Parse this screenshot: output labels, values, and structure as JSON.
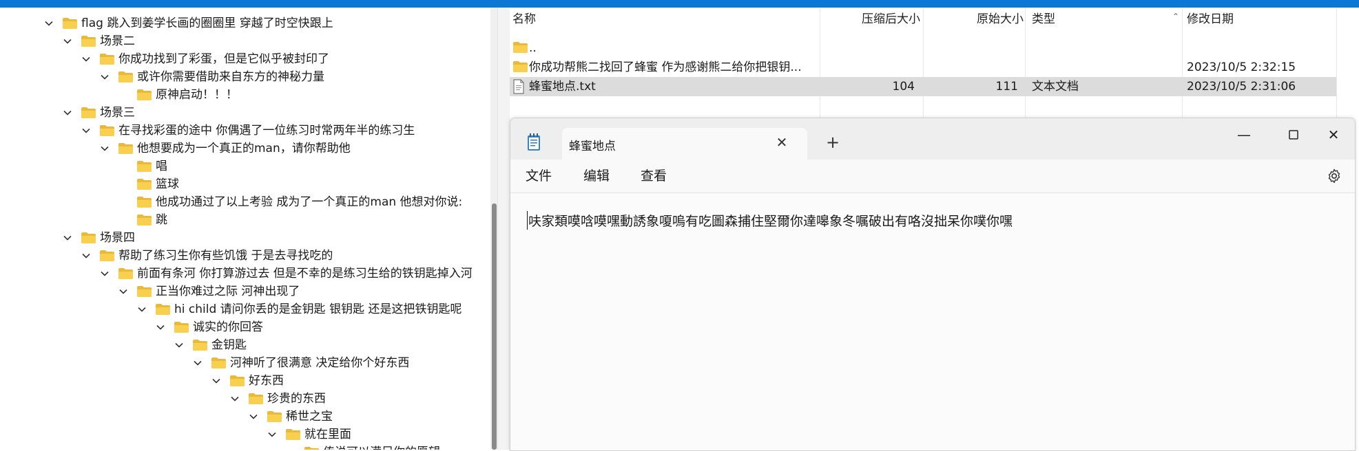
{
  "tree": {
    "nodes": [
      {
        "label": "flag 跳入到姜学长画的圈圈里 穿越了时空快跟上",
        "depth": 0,
        "expanded": true
      },
      {
        "label": "场景二",
        "depth": 1,
        "expanded": true
      },
      {
        "label": "你成功找到了彩蛋，但是它似乎被封印了",
        "depth": 2,
        "expanded": true
      },
      {
        "label": "或许你需要借助来自东方的神秘力量",
        "depth": 3,
        "expanded": true
      },
      {
        "label": "原神启动！！！",
        "depth": 4,
        "expanded": false
      },
      {
        "label": "场景三",
        "depth": 1,
        "expanded": true
      },
      {
        "label": "在寻找彩蛋的途中 你偶遇了一位练习时常两年半的练习生",
        "depth": 2,
        "expanded": true
      },
      {
        "label": "他想要成为一个真正的man，请你帮助他",
        "depth": 3,
        "expanded": true
      },
      {
        "label": "唱",
        "depth": 4,
        "expanded": false
      },
      {
        "label": "篮球",
        "depth": 4,
        "expanded": false
      },
      {
        "label": "他成功通过了以上考验 成为了一个真正的man 他想对你说:",
        "depth": 4,
        "expanded": false
      },
      {
        "label": "跳",
        "depth": 4,
        "expanded": false
      },
      {
        "label": "场景四",
        "depth": 1,
        "expanded": true
      },
      {
        "label": "帮助了练习生你有些饥饿 于是去寻找吃的",
        "depth": 2,
        "expanded": true
      },
      {
        "label": "前面有条河 你打算游过去 但是不幸的是练习生给的铁钥匙掉入河",
        "depth": 3,
        "expanded": true
      },
      {
        "label": "正当你难过之际 河神出现了",
        "depth": 4,
        "expanded": true
      },
      {
        "label": "hi child  请问你丢的是金钥匙 银钥匙 还是这把铁钥匙呢",
        "depth": 5,
        "expanded": true
      },
      {
        "label": "诚实的你回答",
        "depth": 6,
        "expanded": true
      },
      {
        "label": "金钥匙",
        "depth": 7,
        "expanded": true
      },
      {
        "label": "河神听了很满意 决定给你个好东西",
        "depth": 8,
        "expanded": true
      },
      {
        "label": "好东西",
        "depth": 9,
        "expanded": true
      },
      {
        "label": "珍贵的东西",
        "depth": 10,
        "expanded": true
      },
      {
        "label": "稀世之宝",
        "depth": 11,
        "expanded": true
      },
      {
        "label": "就在里面",
        "depth": 12,
        "expanded": true
      },
      {
        "label": "传说可以满足你的愿望",
        "depth": 13,
        "expanded": false
      }
    ]
  },
  "filelist": {
    "headers": {
      "name": "名称",
      "compressed": "压缩后大小",
      "original": "原始大小",
      "type": "类型",
      "modified": "修改日期"
    },
    "rows": [
      {
        "name": "..",
        "compressed": "",
        "original": "",
        "type": "",
        "modified": "",
        "icon": "folder-icon"
      },
      {
        "name": "你成功帮熊二找回了蜂蜜 作为感谢熊二给你把银钥...",
        "compressed": "",
        "original": "",
        "type": "",
        "modified": "2023/10/5 2:32:15",
        "icon": "folder-icon"
      },
      {
        "name": "蜂蜜地点.txt",
        "compressed": "104",
        "original": "111",
        "type": "文本文档",
        "modified": "2023/10/5 2:31:06",
        "icon": "text-file-icon",
        "selected": true
      }
    ]
  },
  "notepad": {
    "tab_title": "蜂蜜地点",
    "menu": {
      "file": "文件",
      "edit": "编辑",
      "view": "查看"
    },
    "content": "呋家類嗼唅嗼嘿動誘象嗄嗚有吃圖森捕住堅爾你達嗥象冬嘱破出有咯沒拙呆你噗你嘿",
    "accent": "#0b78d4"
  }
}
